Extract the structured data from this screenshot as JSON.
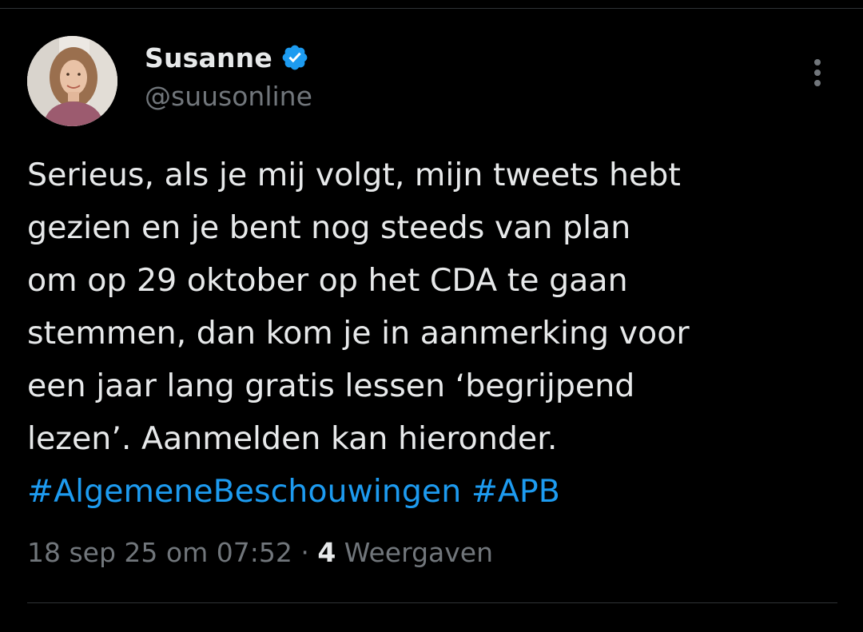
{
  "tweet": {
    "author": {
      "display_name": "Susanne",
      "handle": "@suusonline",
      "verified_badge_icon": "verified-badge-icon",
      "avatar_icon": "user-avatar-photo"
    },
    "more_icon": "more-vertical-icon",
    "text_lines": [
      "Serieus, als je mij volgt, mijn tweets hebt",
      "gezien en je bent nog steeds van plan",
      "om op 29 oktober op het CDA te gaan",
      "stemmen, dan kom je in aanmerking voor",
      "een jaar lang gratis lessen ‘begrijpend",
      "lezen’. Aanmelden kan hieronder."
    ],
    "hashtags": [
      "#AlgemeneBeschouwingen",
      "#APB"
    ],
    "timestamp": "18 sep 25 om 07:52",
    "separator": "·",
    "views_count": "4",
    "views_label": "Weergaven"
  },
  "colors": {
    "background": "#000000",
    "text_primary": "#e7e9ea",
    "text_secondary": "#71767b",
    "link": "#1d9bf0",
    "verified": "#1d9bf0",
    "divider": "#2f3336"
  }
}
